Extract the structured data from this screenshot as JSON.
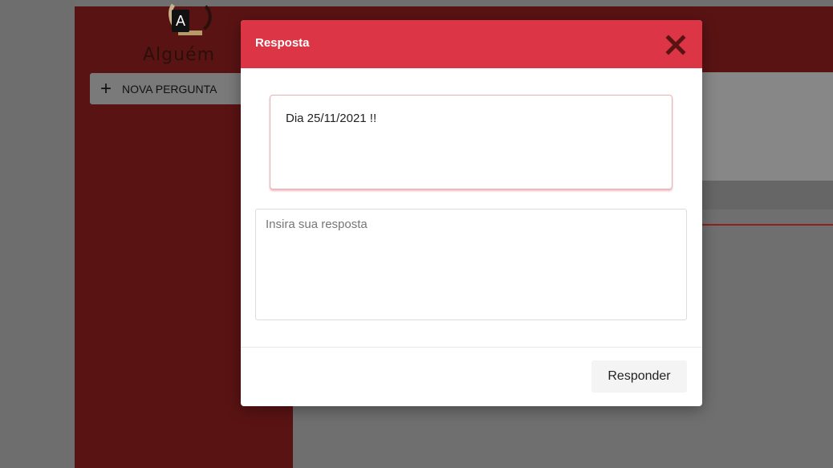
{
  "app": {
    "logo_text": "Alguém",
    "logo_letter": "A",
    "new_question_label": "NOVA PERGUNTA"
  },
  "modal": {
    "title": "Resposta",
    "question_text": "Dia 25/11/2021 !!",
    "answer_placeholder": "Insira sua resposta",
    "answer_value": "",
    "submit_label": "Responder"
  },
  "icons": {
    "close": "close-icon",
    "plus": "plus-icon"
  },
  "colors": {
    "header_red": "#dc3545",
    "sidebar_dark_red": "#5a1313"
  }
}
